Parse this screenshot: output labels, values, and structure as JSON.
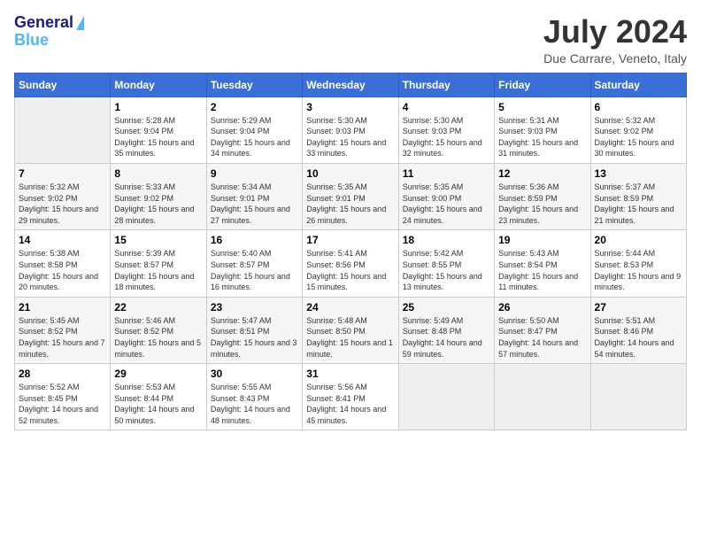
{
  "header": {
    "logo_line1": "General",
    "logo_line2": "Blue",
    "title": "July 2024",
    "subtitle": "Due Carrare, Veneto, Italy"
  },
  "days_of_week": [
    "Sunday",
    "Monday",
    "Tuesday",
    "Wednesday",
    "Thursday",
    "Friday",
    "Saturday"
  ],
  "weeks": [
    [
      {
        "day": "",
        "empty": true
      },
      {
        "day": "1",
        "sunrise": "5:28 AM",
        "sunset": "9:04 PM",
        "daylight": "15 hours and 35 minutes."
      },
      {
        "day": "2",
        "sunrise": "5:29 AM",
        "sunset": "9:04 PM",
        "daylight": "15 hours and 34 minutes."
      },
      {
        "day": "3",
        "sunrise": "5:30 AM",
        "sunset": "9:03 PM",
        "daylight": "15 hours and 33 minutes."
      },
      {
        "day": "4",
        "sunrise": "5:30 AM",
        "sunset": "9:03 PM",
        "daylight": "15 hours and 32 minutes."
      },
      {
        "day": "5",
        "sunrise": "5:31 AM",
        "sunset": "9:03 PM",
        "daylight": "15 hours and 31 minutes."
      },
      {
        "day": "6",
        "sunrise": "5:32 AM",
        "sunset": "9:02 PM",
        "daylight": "15 hours and 30 minutes."
      }
    ],
    [
      {
        "day": "7",
        "sunrise": "5:32 AM",
        "sunset": "9:02 PM",
        "daylight": "15 hours and 29 minutes."
      },
      {
        "day": "8",
        "sunrise": "5:33 AM",
        "sunset": "9:02 PM",
        "daylight": "15 hours and 28 minutes."
      },
      {
        "day": "9",
        "sunrise": "5:34 AM",
        "sunset": "9:01 PM",
        "daylight": "15 hours and 27 minutes."
      },
      {
        "day": "10",
        "sunrise": "5:35 AM",
        "sunset": "9:01 PM",
        "daylight": "15 hours and 26 minutes."
      },
      {
        "day": "11",
        "sunrise": "5:35 AM",
        "sunset": "9:00 PM",
        "daylight": "15 hours and 24 minutes."
      },
      {
        "day": "12",
        "sunrise": "5:36 AM",
        "sunset": "8:59 PM",
        "daylight": "15 hours and 23 minutes."
      },
      {
        "day": "13",
        "sunrise": "5:37 AM",
        "sunset": "8:59 PM",
        "daylight": "15 hours and 21 minutes."
      }
    ],
    [
      {
        "day": "14",
        "sunrise": "5:38 AM",
        "sunset": "8:58 PM",
        "daylight": "15 hours and 20 minutes."
      },
      {
        "day": "15",
        "sunrise": "5:39 AM",
        "sunset": "8:57 PM",
        "daylight": "15 hours and 18 minutes."
      },
      {
        "day": "16",
        "sunrise": "5:40 AM",
        "sunset": "8:57 PM",
        "daylight": "15 hours and 16 minutes."
      },
      {
        "day": "17",
        "sunrise": "5:41 AM",
        "sunset": "8:56 PM",
        "daylight": "15 hours and 15 minutes."
      },
      {
        "day": "18",
        "sunrise": "5:42 AM",
        "sunset": "8:55 PM",
        "daylight": "15 hours and 13 minutes."
      },
      {
        "day": "19",
        "sunrise": "5:43 AM",
        "sunset": "8:54 PM",
        "daylight": "15 hours and 11 minutes."
      },
      {
        "day": "20",
        "sunrise": "5:44 AM",
        "sunset": "8:53 PM",
        "daylight": "15 hours and 9 minutes."
      }
    ],
    [
      {
        "day": "21",
        "sunrise": "5:45 AM",
        "sunset": "8:52 PM",
        "daylight": "15 hours and 7 minutes."
      },
      {
        "day": "22",
        "sunrise": "5:46 AM",
        "sunset": "8:52 PM",
        "daylight": "15 hours and 5 minutes."
      },
      {
        "day": "23",
        "sunrise": "5:47 AM",
        "sunset": "8:51 PM",
        "daylight": "15 hours and 3 minutes."
      },
      {
        "day": "24",
        "sunrise": "5:48 AM",
        "sunset": "8:50 PM",
        "daylight": "15 hours and 1 minute."
      },
      {
        "day": "25",
        "sunrise": "5:49 AM",
        "sunset": "8:48 PM",
        "daylight": "14 hours and 59 minutes."
      },
      {
        "day": "26",
        "sunrise": "5:50 AM",
        "sunset": "8:47 PM",
        "daylight": "14 hours and 57 minutes."
      },
      {
        "day": "27",
        "sunrise": "5:51 AM",
        "sunset": "8:46 PM",
        "daylight": "14 hours and 54 minutes."
      }
    ],
    [
      {
        "day": "28",
        "sunrise": "5:52 AM",
        "sunset": "8:45 PM",
        "daylight": "14 hours and 52 minutes."
      },
      {
        "day": "29",
        "sunrise": "5:53 AM",
        "sunset": "8:44 PM",
        "daylight": "14 hours and 50 minutes."
      },
      {
        "day": "30",
        "sunrise": "5:55 AM",
        "sunset": "8:43 PM",
        "daylight": "14 hours and 48 minutes."
      },
      {
        "day": "31",
        "sunrise": "5:56 AM",
        "sunset": "8:41 PM",
        "daylight": "14 hours and 45 minutes."
      },
      {
        "day": "",
        "empty": true
      },
      {
        "day": "",
        "empty": true
      },
      {
        "day": "",
        "empty": true
      }
    ]
  ]
}
